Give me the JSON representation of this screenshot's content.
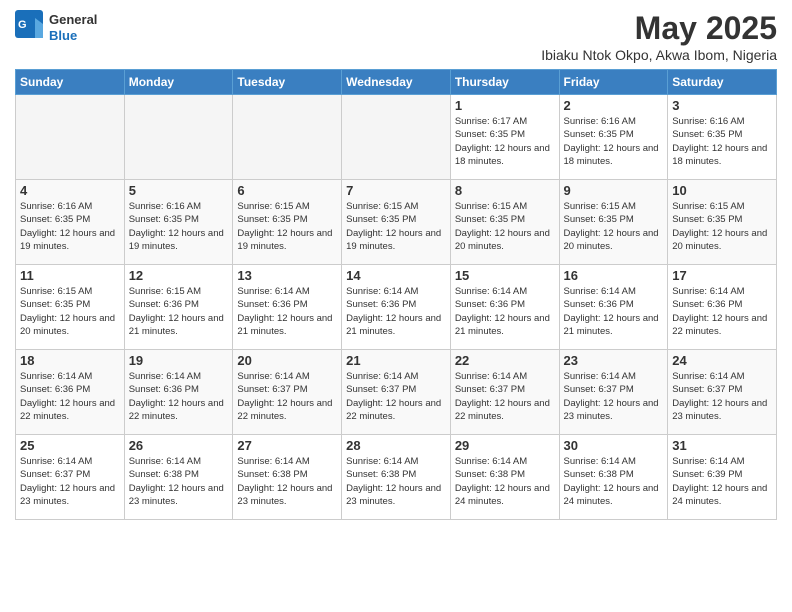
{
  "header": {
    "logo_general": "General",
    "logo_blue": "Blue",
    "month_title": "May 2025",
    "subtitle": "Ibiaku Ntok Okpo, Akwa Ibom, Nigeria"
  },
  "weekdays": [
    "Sunday",
    "Monday",
    "Tuesday",
    "Wednesday",
    "Thursday",
    "Friday",
    "Saturday"
  ],
  "weeks": [
    [
      {
        "day": "",
        "empty": true
      },
      {
        "day": "",
        "empty": true
      },
      {
        "day": "",
        "empty": true
      },
      {
        "day": "",
        "empty": true
      },
      {
        "day": "1",
        "sunrise": "6:17 AM",
        "sunset": "6:35 PM",
        "daylight": "12 hours and 18 minutes."
      },
      {
        "day": "2",
        "sunrise": "6:16 AM",
        "sunset": "6:35 PM",
        "daylight": "12 hours and 18 minutes."
      },
      {
        "day": "3",
        "sunrise": "6:16 AM",
        "sunset": "6:35 PM",
        "daylight": "12 hours and 18 minutes."
      }
    ],
    [
      {
        "day": "4",
        "sunrise": "6:16 AM",
        "sunset": "6:35 PM",
        "daylight": "12 hours and 19 minutes."
      },
      {
        "day": "5",
        "sunrise": "6:16 AM",
        "sunset": "6:35 PM",
        "daylight": "12 hours and 19 minutes."
      },
      {
        "day": "6",
        "sunrise": "6:15 AM",
        "sunset": "6:35 PM",
        "daylight": "12 hours and 19 minutes."
      },
      {
        "day": "7",
        "sunrise": "6:15 AM",
        "sunset": "6:35 PM",
        "daylight": "12 hours and 19 minutes."
      },
      {
        "day": "8",
        "sunrise": "6:15 AM",
        "sunset": "6:35 PM",
        "daylight": "12 hours and 20 minutes."
      },
      {
        "day": "9",
        "sunrise": "6:15 AM",
        "sunset": "6:35 PM",
        "daylight": "12 hours and 20 minutes."
      },
      {
        "day": "10",
        "sunrise": "6:15 AM",
        "sunset": "6:35 PM",
        "daylight": "12 hours and 20 minutes."
      }
    ],
    [
      {
        "day": "11",
        "sunrise": "6:15 AM",
        "sunset": "6:35 PM",
        "daylight": "12 hours and 20 minutes."
      },
      {
        "day": "12",
        "sunrise": "6:15 AM",
        "sunset": "6:36 PM",
        "daylight": "12 hours and 21 minutes."
      },
      {
        "day": "13",
        "sunrise": "6:14 AM",
        "sunset": "6:36 PM",
        "daylight": "12 hours and 21 minutes."
      },
      {
        "day": "14",
        "sunrise": "6:14 AM",
        "sunset": "6:36 PM",
        "daylight": "12 hours and 21 minutes."
      },
      {
        "day": "15",
        "sunrise": "6:14 AM",
        "sunset": "6:36 PM",
        "daylight": "12 hours and 21 minutes."
      },
      {
        "day": "16",
        "sunrise": "6:14 AM",
        "sunset": "6:36 PM",
        "daylight": "12 hours and 21 minutes."
      },
      {
        "day": "17",
        "sunrise": "6:14 AM",
        "sunset": "6:36 PM",
        "daylight": "12 hours and 22 minutes."
      }
    ],
    [
      {
        "day": "18",
        "sunrise": "6:14 AM",
        "sunset": "6:36 PM",
        "daylight": "12 hours and 22 minutes."
      },
      {
        "day": "19",
        "sunrise": "6:14 AM",
        "sunset": "6:36 PM",
        "daylight": "12 hours and 22 minutes."
      },
      {
        "day": "20",
        "sunrise": "6:14 AM",
        "sunset": "6:37 PM",
        "daylight": "12 hours and 22 minutes."
      },
      {
        "day": "21",
        "sunrise": "6:14 AM",
        "sunset": "6:37 PM",
        "daylight": "12 hours and 22 minutes."
      },
      {
        "day": "22",
        "sunrise": "6:14 AM",
        "sunset": "6:37 PM",
        "daylight": "12 hours and 22 minutes."
      },
      {
        "day": "23",
        "sunrise": "6:14 AM",
        "sunset": "6:37 PM",
        "daylight": "12 hours and 23 minutes."
      },
      {
        "day": "24",
        "sunrise": "6:14 AM",
        "sunset": "6:37 PM",
        "daylight": "12 hours and 23 minutes."
      }
    ],
    [
      {
        "day": "25",
        "sunrise": "6:14 AM",
        "sunset": "6:37 PM",
        "daylight": "12 hours and 23 minutes."
      },
      {
        "day": "26",
        "sunrise": "6:14 AM",
        "sunset": "6:38 PM",
        "daylight": "12 hours and 23 minutes."
      },
      {
        "day": "27",
        "sunrise": "6:14 AM",
        "sunset": "6:38 PM",
        "daylight": "12 hours and 23 minutes."
      },
      {
        "day": "28",
        "sunrise": "6:14 AM",
        "sunset": "6:38 PM",
        "daylight": "12 hours and 23 minutes."
      },
      {
        "day": "29",
        "sunrise": "6:14 AM",
        "sunset": "6:38 PM",
        "daylight": "12 hours and 24 minutes."
      },
      {
        "day": "30",
        "sunrise": "6:14 AM",
        "sunset": "6:38 PM",
        "daylight": "12 hours and 24 minutes."
      },
      {
        "day": "31",
        "sunrise": "6:14 AM",
        "sunset": "6:39 PM",
        "daylight": "12 hours and 24 minutes."
      }
    ]
  ]
}
